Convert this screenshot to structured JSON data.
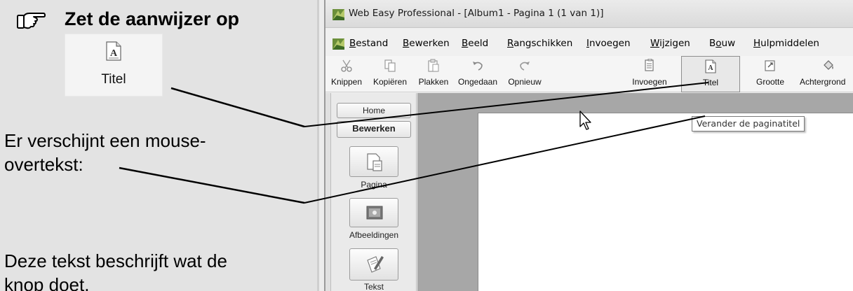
{
  "instructions": {
    "heading": "Zet de aanwijzer op",
    "preview_button": {
      "label": "Titel",
      "icon": "title-page-icon"
    },
    "paragraph1_line1": "Er verschijnt een mouse-",
    "paragraph1_line2": "overtekst:",
    "paragraph2_line1": "Deze tekst beschrijft wat de",
    "paragraph2_line2": "knop doet."
  },
  "window": {
    "title": "Web Easy Professional - [Album1 - Pagina 1 (1 van 1)]",
    "menu": [
      {
        "pre": "",
        "u": "B",
        "post": "estand"
      },
      {
        "pre": "",
        "u": "B",
        "post": "ewerken"
      },
      {
        "pre": "",
        "u": "B",
        "post": "eeld"
      },
      {
        "pre": "",
        "u": "R",
        "post": "angschikken"
      },
      {
        "pre": "",
        "u": "I",
        "post": "nvoegen"
      },
      {
        "pre": "",
        "u": "W",
        "post": "ijzigen"
      },
      {
        "pre": "B",
        "u": "o",
        "post": "uw"
      },
      {
        "pre": "",
        "u": "H",
        "post": "ulpmiddelen"
      }
    ],
    "toolbar": [
      {
        "label": "Knippen",
        "icon": "scissors-icon"
      },
      {
        "label": "Kopiëren",
        "icon": "copy-icon"
      },
      {
        "label": "Plakken",
        "icon": "paste-icon"
      },
      {
        "label": "Ongedaan",
        "icon": "undo-icon"
      },
      {
        "label": "Opnieuw",
        "icon": "redo-icon"
      },
      {
        "label": "Invoegen",
        "icon": "insert-icon"
      },
      {
        "label": "Titel",
        "icon": "title-page-icon"
      },
      {
        "label": "Grootte",
        "icon": "resize-icon"
      },
      {
        "label": "Achtergrond",
        "icon": "fill-bucket-icon"
      }
    ],
    "nav": {
      "tab_home": "Home",
      "tab_edit": "Bewerken",
      "items": [
        {
          "label": "Pagina",
          "icon": "page-icon"
        },
        {
          "label": "Afbeeldingen",
          "icon": "picture-icon"
        },
        {
          "label": "Tekst",
          "icon": "text-pen-icon"
        }
      ]
    },
    "tooltip": "Verander de paginatitel"
  }
}
